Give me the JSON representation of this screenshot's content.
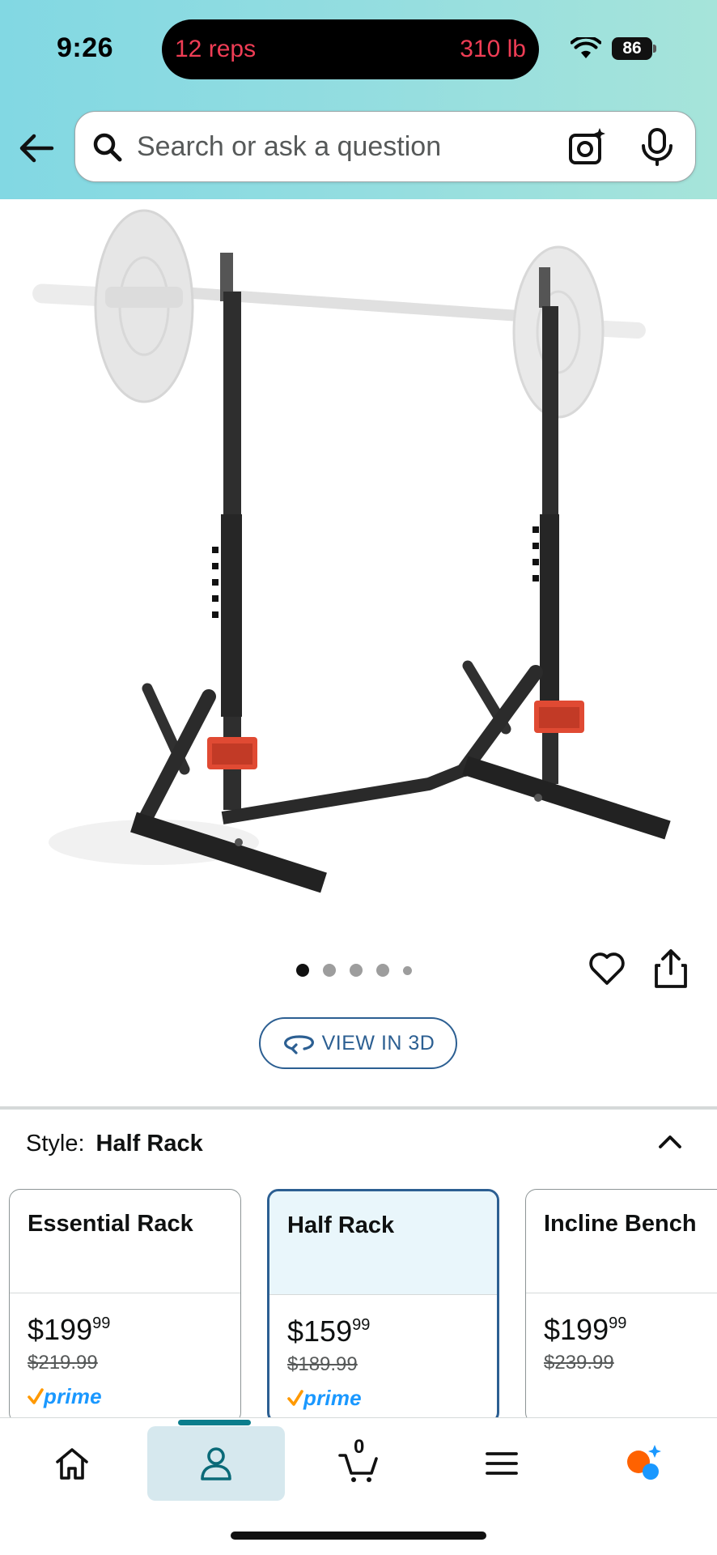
{
  "status_bar": {
    "time": "9:26",
    "live_activity": {
      "left": "12 reps",
      "right": "310 lb"
    },
    "battery": "86"
  },
  "search": {
    "placeholder": "Search or ask a question"
  },
  "gallery": {
    "page_count": 5,
    "active_index": 0
  },
  "view_3d": {
    "label": "VIEW IN 3D"
  },
  "style_selector": {
    "label": "Style:",
    "selected": "Half Rack",
    "options": [
      {
        "name": "Essential Rack",
        "price_dollars": "$199",
        "price_cents": "99",
        "list_price": "$219.99",
        "prime": "prime",
        "selected": false
      },
      {
        "name": "Half Rack",
        "price_dollars": "$159",
        "price_cents": "99",
        "list_price": "$189.99",
        "prime": "prime",
        "selected": true
      },
      {
        "name": "Incline Bench",
        "price_dollars": "$199",
        "price_cents": "99",
        "list_price": "$239.99",
        "prime": "",
        "selected": false
      }
    ]
  },
  "bottom_nav": {
    "items": [
      {
        "id": "home",
        "icon": "home-icon"
      },
      {
        "id": "account",
        "icon": "person-icon",
        "active": true
      },
      {
        "id": "cart",
        "icon": "cart-icon",
        "count": "0"
      },
      {
        "id": "menu",
        "icon": "menu-icon"
      },
      {
        "id": "rufus",
        "icon": "rufus-assistant-icon"
      }
    ]
  },
  "colors": {
    "header_gradient_start": "#82d8e3",
    "header_gradient_end": "#a6e4da",
    "accent_blue": "#2c5f92",
    "prime_blue": "#1a98ff",
    "prime_orange": "#ff9900",
    "nav_active_bg": "#d6e8ee"
  }
}
